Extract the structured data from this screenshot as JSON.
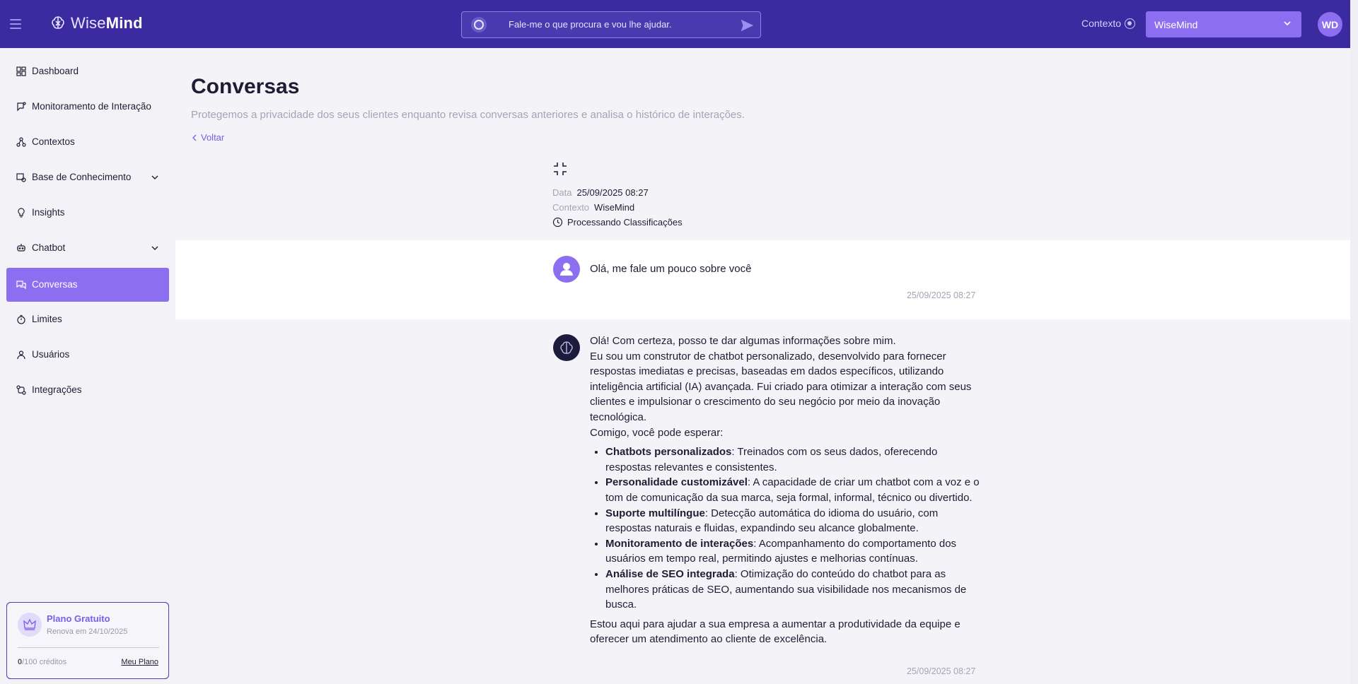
{
  "topbar": {
    "brand_light": "Wise",
    "brand_bold": "Mind",
    "search_placeholder": "Fale-me o que procura e vou lhe ajudar.",
    "context_label": "Contexto",
    "context_value": "WiseMind",
    "avatar_initials": "WD"
  },
  "sidebar": {
    "items": [
      {
        "label": "Dashboard"
      },
      {
        "label": "Monitoramento de Interação"
      },
      {
        "label": "Contextos"
      },
      {
        "label": "Base de Conhecimento"
      },
      {
        "label": "Insights"
      },
      {
        "label": "Chatbot"
      },
      {
        "label": "Conversas"
      },
      {
        "label": "Limites"
      },
      {
        "label": "Usuários"
      },
      {
        "label": "Integrações"
      }
    ],
    "plan": {
      "title": "Plano Gratuito",
      "renew": "Renova em 24/10/2025",
      "credits_used": "0",
      "credits_total": "/100 créditos",
      "my_plan": "Meu Plano"
    }
  },
  "page": {
    "title": "Conversas",
    "subtitle": "Protegemos a privacidade dos seus clientes enquanto revisa conversas anteriores e analisa o histórico de interações.",
    "back": "Voltar",
    "meta": {
      "date_label": "Data",
      "date_value": "25/09/2025 08:27",
      "context_label": "Contexto",
      "context_value": "WiseMind",
      "status": "Processando Classificações"
    }
  },
  "conversation": {
    "user_message": "Olá, me fale um pouco sobre você",
    "user_time": "25/09/2025 08:27",
    "bot_intro_1": "Olá! Com certeza, posso te dar algumas informações sobre mim.",
    "bot_intro_2": "Eu sou um construtor de chatbot personalizado, desenvolvido para fornecer respostas imediatas e precisas, baseadas em dados específicos, utilizando inteligência artificial (IA) avançada. Fui criado para otimizar a interação com seus clientes e impulsionar o crescimento do seu negócio por meio da inovação tecnológica.",
    "bot_intro_3": "Comigo, você pode esperar:",
    "features": [
      {
        "title": "Chatbots personalizados",
        "text": ": Treinados com os seus dados, oferecendo respostas relevantes e consistentes."
      },
      {
        "title": "Personalidade customizável",
        "text": ": A capacidade de criar um chatbot com a voz e o tom de comunicação da sua marca, seja formal, informal, técnico ou divertido."
      },
      {
        "title": "Suporte multilíngue",
        "text": ": Detecção automática do idioma do usuário, com respostas naturais e fluidas, expandindo seu alcance globalmente."
      },
      {
        "title": "Monitoramento de interações",
        "text": ": Acompanhamento do comportamento dos usuários em tempo real, permitindo ajustes e melhorias contínuas."
      },
      {
        "title": "Análise de SEO integrada",
        "text": ": Otimização do conteúdo do chatbot para as melhores práticas de SEO, aumentando sua visibilidade nos mecanismos de busca."
      }
    ],
    "bot_outro": "Estou aqui para ajudar a sua empresa a aumentar a produtividade da equipe e oferecer um atendimento ao cliente de excelência.",
    "bot_time": "25/09/2025 08:27"
  },
  "colors": {
    "topbar": "#3b2aa0",
    "accent": "#8b6ff0",
    "accent_text": "#7a5de8"
  }
}
